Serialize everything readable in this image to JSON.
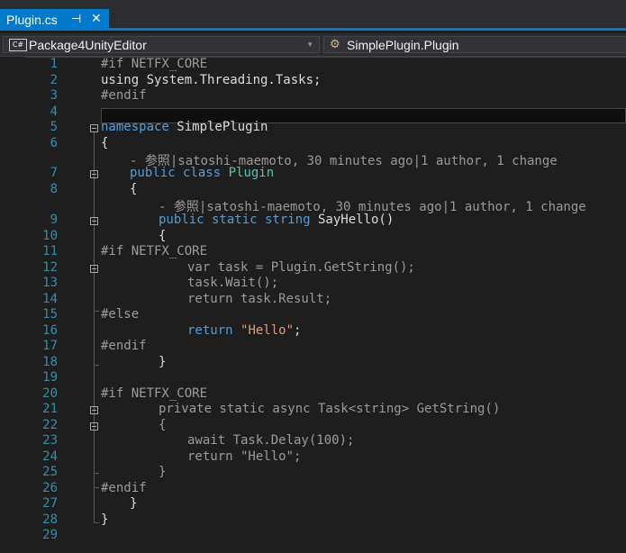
{
  "tab": {
    "filename": "Plugin.cs",
    "pin_glyph": "⊣",
    "close_glyph": "✕"
  },
  "navbar": {
    "project_badge": "C#",
    "project": "Package4UnityEditor",
    "member": "SimplePlugin.Plugin",
    "dropdown_glyph": "▾",
    "member_icon_glyph": "⚙"
  },
  "line_numbers": [
    "1",
    "2",
    "3",
    "4",
    "5",
    "6",
    "7",
    "8",
    "9",
    "10",
    "11",
    "12",
    "13",
    "14",
    "15",
    "16",
    "17",
    "18",
    "19",
    "20",
    "21",
    "22",
    "23",
    "24",
    "25",
    "26",
    "27",
    "28",
    "29"
  ],
  "code": {
    "l1": {
      "pp": "#if NETFX_CORE"
    },
    "l2": {
      "text": "using System.Threading.Tasks;"
    },
    "l3": {
      "pp": "#endif"
    },
    "l5": {
      "kw": "namespace",
      "rest": " SimplePlugin"
    },
    "l6": {
      "text": "{"
    },
    "lens1": {
      "text": "- 参照|satoshi-maemoto, 30 minutes ago|1 author, 1 change"
    },
    "l7": {
      "kw": "public class",
      "ty": "Plugin"
    },
    "l8": {
      "text": "{"
    },
    "lens2": {
      "text": "- 参照|satoshi-maemoto, 30 minutes ago|1 author, 1 change"
    },
    "l9": {
      "kw": "public static string",
      "rest": " SayHello()"
    },
    "l10": {
      "text": "{"
    },
    "l11": {
      "pp": "#if NETFX_CORE"
    },
    "l12": {
      "text": "var task = Plugin.GetString();"
    },
    "l13": {
      "text": "task.Wait();"
    },
    "l14": {
      "text": "return task.Result;"
    },
    "l15": {
      "pp": "#else"
    },
    "l16": {
      "kw": "return",
      "st": "\"Hello\"",
      "rest": ";"
    },
    "l17": {
      "pp": "#endif"
    },
    "l18": {
      "text": "}"
    },
    "l20": {
      "pp": "#if NETFX_CORE"
    },
    "l21": {
      "text": "private static async Task<string> GetString()"
    },
    "l22": {
      "text": "{"
    },
    "l23": {
      "text": "await Task.Delay(100);"
    },
    "l24": {
      "text": "return \"Hello\";"
    },
    "l25": {
      "text": "}"
    },
    "l26": {
      "pp": "#endif"
    },
    "l27": {
      "text": "}"
    },
    "l28": {
      "text": "}"
    }
  },
  "colors": {
    "keyword": "#569cd6",
    "type": "#4ec9b0",
    "string": "#d69d85",
    "preprocessor": "#9b9b9b",
    "line_number": "#2b91af",
    "accent": "#007acc"
  }
}
